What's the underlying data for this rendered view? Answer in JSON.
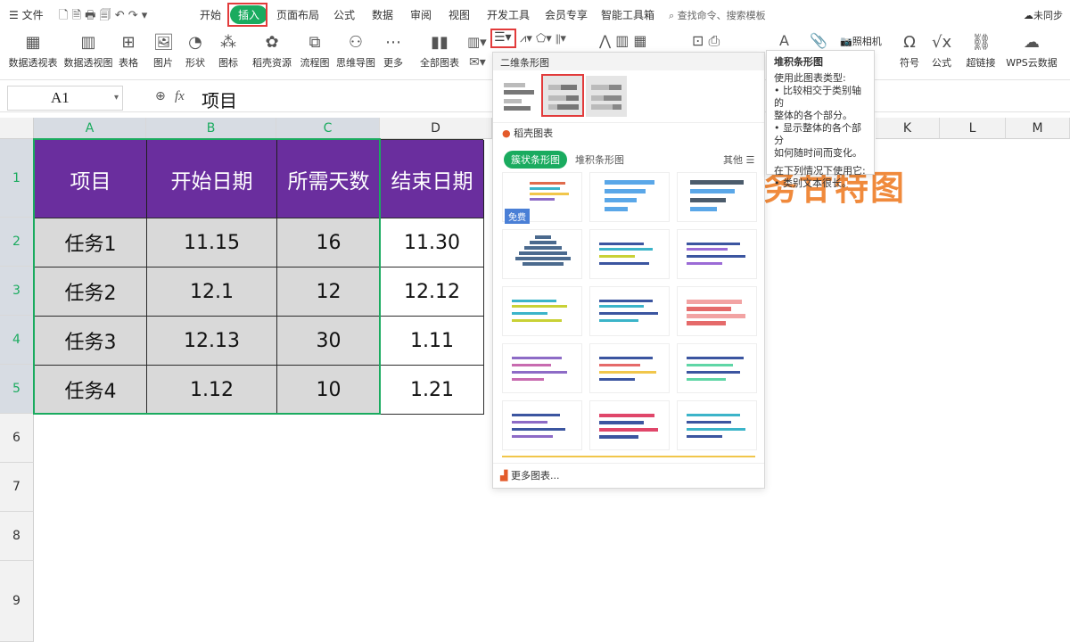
{
  "tabbar": {
    "file": "文件",
    "tabs": [
      "开始",
      "插入",
      "页面布局",
      "公式",
      "数据",
      "审阅",
      "视图",
      "开发工具",
      "会员专享",
      "智能工具箱"
    ],
    "search": "查找命令、搜索模板",
    "sync": "未同步"
  },
  "ribbon": {
    "items": [
      "数据透视表",
      "数据透视图",
      "表格",
      "图片",
      "形状",
      "图标",
      "稻壳资源",
      "流程图",
      "思维导图",
      "更多",
      "全部图表"
    ],
    "right_items": [
      "照相机",
      "符号",
      "公式",
      "超链接",
      "WPS云数据"
    ]
  },
  "formula": {
    "cell_ref": "A1",
    "fx": "fx",
    "value": "项目"
  },
  "columns": [
    "A",
    "B",
    "C",
    "D",
    "K",
    "L",
    "M"
  ],
  "rows": [
    "1",
    "2",
    "3",
    "4",
    "5",
    "6",
    "7",
    "8",
    "9"
  ],
  "table": {
    "headers": [
      "项目",
      "开始日期",
      "所需天数",
      "结束日期"
    ],
    "rows": [
      [
        "任务1",
        "11.15",
        "16",
        "11.30"
      ],
      [
        "任务2",
        "12.1",
        "12",
        "12.12"
      ],
      [
        "任务3",
        "12.13",
        "30",
        "1.11"
      ],
      [
        "任务4",
        "1.12",
        "10",
        "1.21"
      ]
    ]
  },
  "bg_title": "务甘特图",
  "dropdown": {
    "section1": "二维条形图",
    "section2": "稻壳图表",
    "tab_active": "簇状条形图",
    "tab2": "堆积条形图",
    "other": "其他",
    "free": "免费",
    "more": "更多图表..."
  },
  "tooltip": {
    "title": "堆积条形图",
    "lines": [
      "使用此图表类型:",
      "• 比较相交于类别轴的",
      "整体的各个部分。",
      "• 显示整体的各个部分",
      "如何随时间而变化。",
      "",
      "在下列情况下使用它:",
      "• 类别文本很长。"
    ]
  },
  "colors": {
    "accent": "#1aab5f",
    "header_purple": "#6a2e9e",
    "highlight": "#e23b3b",
    "orange": "#f08a3c"
  }
}
